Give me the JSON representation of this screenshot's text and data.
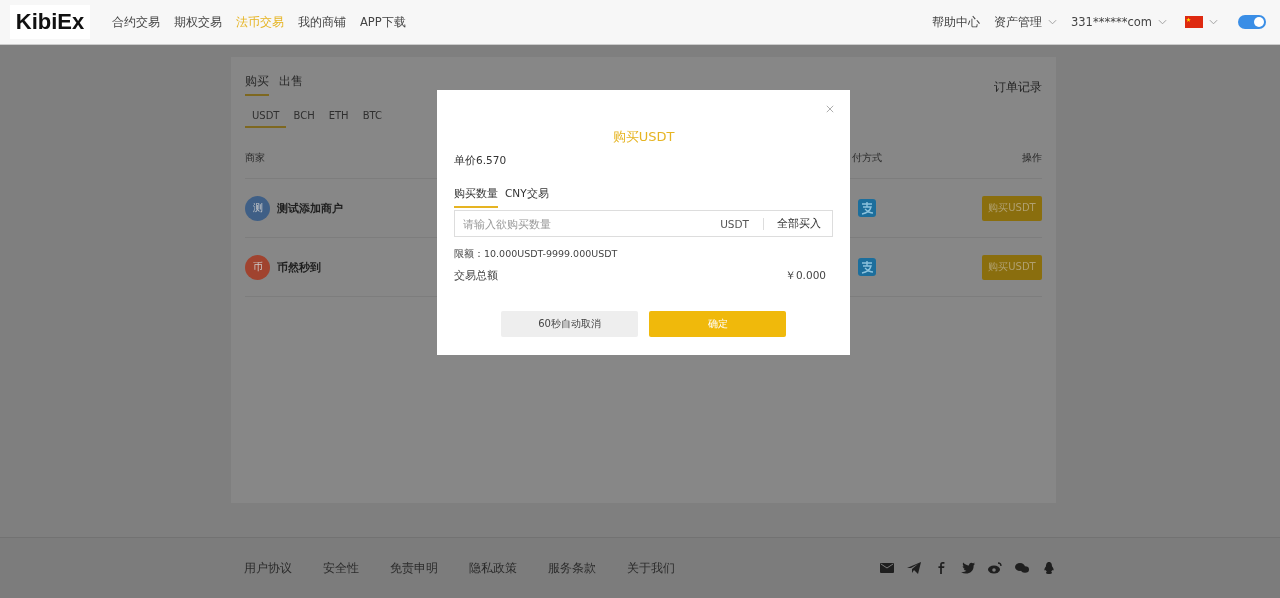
{
  "header": {
    "logo": "KibiEx",
    "nav": [
      {
        "label": "合约交易",
        "selected": false
      },
      {
        "label": "期权交易",
        "selected": false
      },
      {
        "label": "法币交易",
        "selected": true
      },
      {
        "label": "我的商铺",
        "selected": false
      },
      {
        "label": "APP下载",
        "selected": false
      }
    ],
    "help": "帮助中心",
    "assets": "资产管理",
    "account": "331******com",
    "theme_toggle": {
      "on": true
    }
  },
  "market": {
    "trade_tabs": [
      {
        "label": "购买",
        "selected": true
      },
      {
        "label": "出售",
        "selected": false
      }
    ],
    "coin_tabs": [
      {
        "label": "USDT",
        "selected": true
      },
      {
        "label": "BCH",
        "selected": false
      },
      {
        "label": "ETH",
        "selected": false
      },
      {
        "label": "BTC",
        "selected": false
      }
    ],
    "order_record": "订单记录",
    "columns": [
      "商家",
      "付方式",
      "操作"
    ],
    "rows": [
      {
        "avatar": "测",
        "color": "#3f5f86",
        "merchant": "测试添加商户",
        "payment": {
          "kind": "alipay"
        },
        "action": "购买USDT"
      },
      {
        "avatar": "币",
        "color": "#a0432f",
        "merchant": "币然秒到",
        "payment": {
          "kind": "alipay"
        },
        "action": "购买USDT"
      }
    ]
  },
  "dialog": {
    "title": "购买USDT",
    "price": "单价6.570",
    "tabs": [
      {
        "label": "购买数量",
        "selected": true
      },
      {
        "label": "CNY交易",
        "selected": false
      }
    ],
    "input": {
      "placeholder": "请输入欲购买数量",
      "unit": "USDT",
      "all_button": "全部买入"
    },
    "limit": "限额：10.000USDT-9999.000USDT",
    "total_label": "交易总额",
    "total_value": "￥0.000",
    "cancel": "60秒自动取消",
    "confirm": "确定"
  },
  "footer": {
    "links": [
      "用户协议",
      "安全性",
      "免责申明",
      "隐私政策",
      "服务条款",
      "关于我们"
    ]
  }
}
